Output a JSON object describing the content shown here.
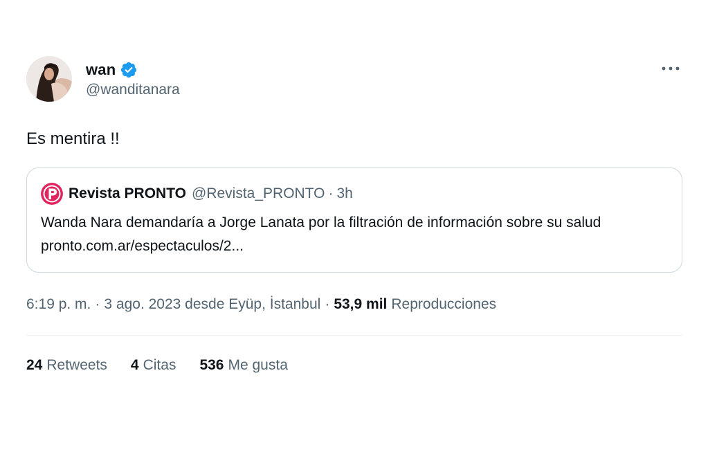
{
  "author": {
    "display_name": "wan",
    "handle": "@wanditanara",
    "verified_icon": "verified-badge-icon",
    "verified_color": "#1d9bf0"
  },
  "more_icon": "more-horizontal-icon",
  "tweet": {
    "text": "Es mentira !!"
  },
  "quote": {
    "logo_icon": "pronto-logo-icon",
    "logo_color": "#e0245e",
    "name": "Revista PRONTO",
    "handle": "@Revista_PRONTO",
    "dot": "·",
    "time": "3h",
    "body": "Wanda Nara demandaría a Jorge Lanata por la filtración de información sobre su salud",
    "link": "pronto.com.ar/espectaculos/2..."
  },
  "meta": {
    "time": "6:19 p. m.",
    "sep1": "·",
    "date": "3 ago. 2023 desde Eyüp, İstanbul",
    "sep2": "·",
    "views_count": "53,9 mil",
    "views_label": "Reproducciones"
  },
  "stats": {
    "retweets_count": "24",
    "retweets_label": "Retweets",
    "quotes_count": "4",
    "quotes_label": "Citas",
    "likes_count": "536",
    "likes_label": "Me gusta"
  }
}
